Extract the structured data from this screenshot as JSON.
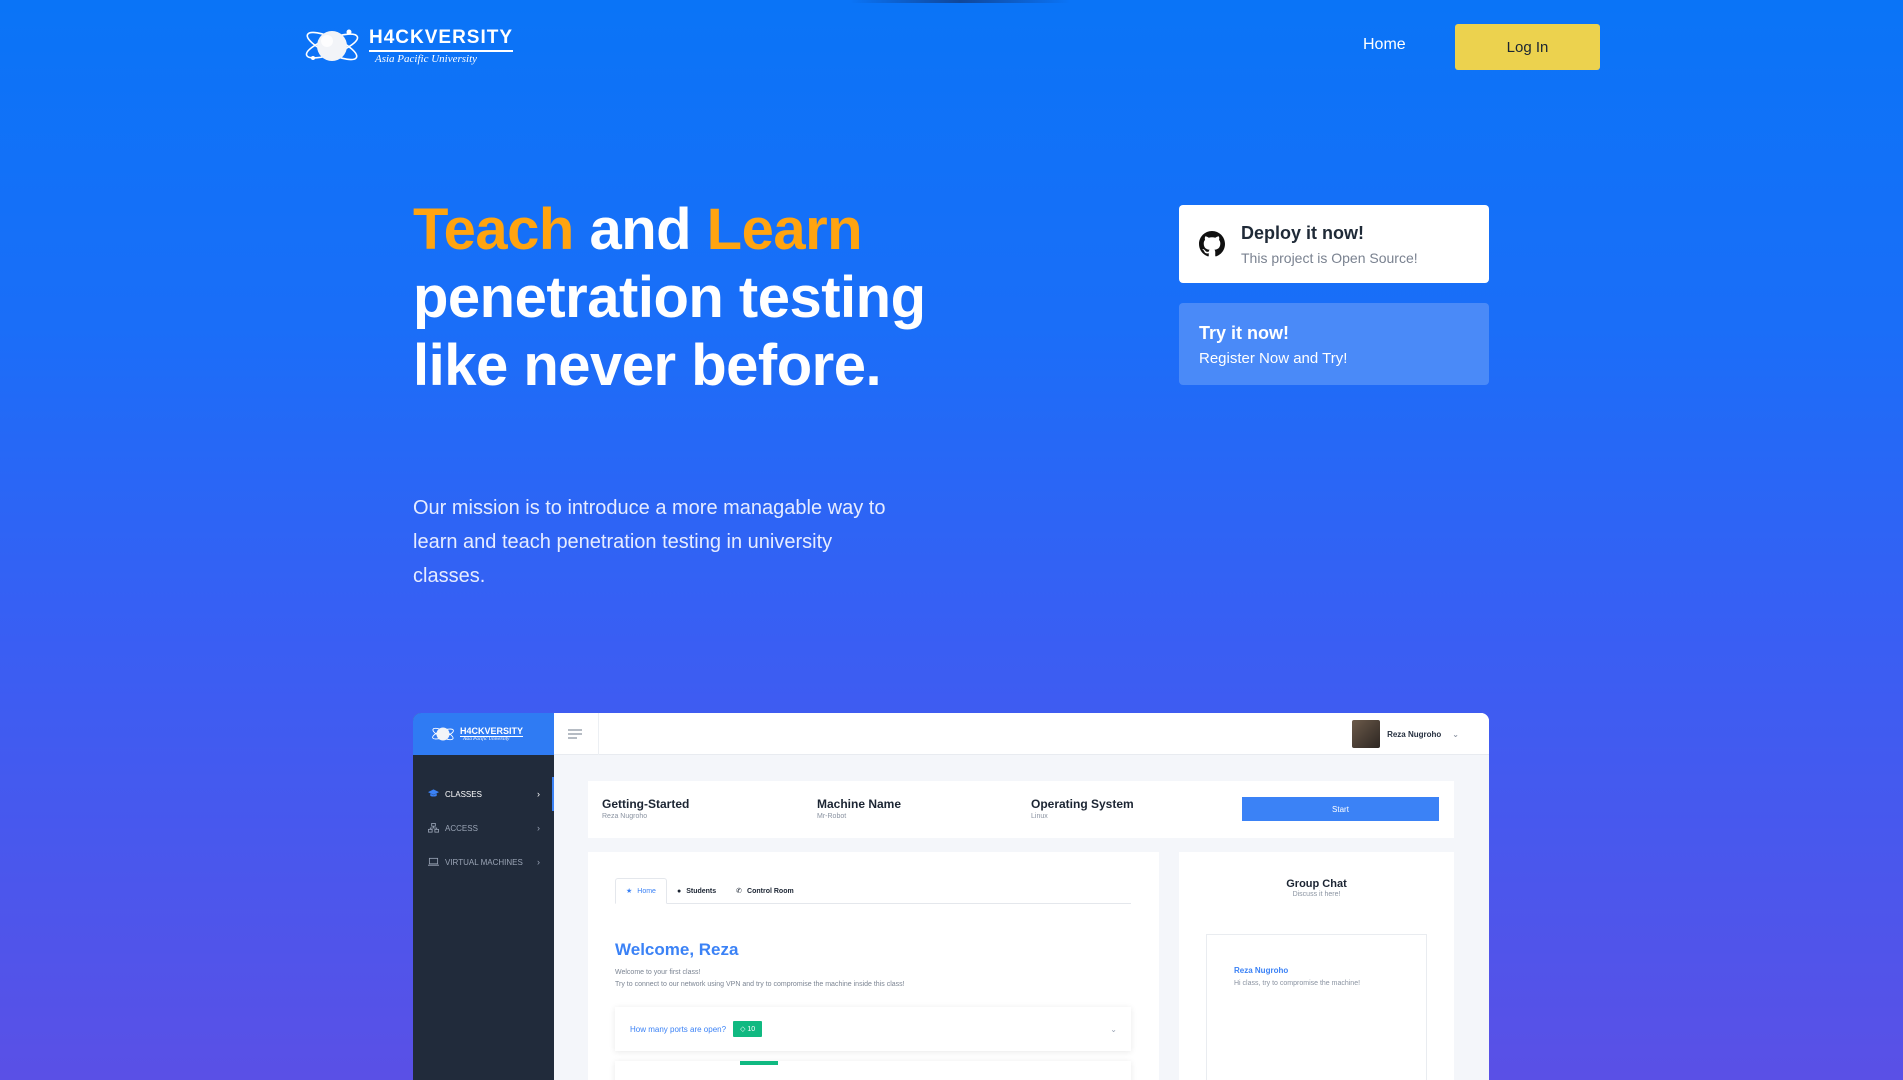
{
  "brand": {
    "name": "H4CKVERSITY",
    "subtitle": "Asia Pacific University",
    "globe_icon": "globe-icon"
  },
  "nav": {
    "home": "Home",
    "login": "Log In"
  },
  "hero": {
    "title_word1": "Teach",
    "title_and": " and ",
    "title_word2": "Learn",
    "title_rest": "penetration testing like never before.",
    "description": "Our mission is to introduce a more managable way to learn and teach penetration testing in university classes."
  },
  "cards": {
    "deploy": {
      "icon": "github-icon",
      "title": "Deploy it now!",
      "subtitle": "This project is Open Source!"
    },
    "try": {
      "title": "Try it now!",
      "subtitle": "Register Now and Try!"
    }
  },
  "preview": {
    "sidebar": {
      "brand": "H4CKVERSITY",
      "brand_sub": "Asia Pacific University",
      "items": [
        {
          "label": "CLASSES",
          "icon": "graduation-cap-icon",
          "active": true
        },
        {
          "label": "ACCESS",
          "icon": "network-icon",
          "active": false
        },
        {
          "label": "VIRTUAL MACHINES",
          "icon": "laptop-icon",
          "active": false
        }
      ]
    },
    "user": {
      "name": "Reza Nugroho"
    },
    "class_strip": {
      "class_name": "Getting-Started",
      "class_owner": "Reza Nugroho",
      "machine_label": "Machine Name",
      "machine_value": "Mr-Robot",
      "os_label": "Operating System",
      "os_value": "Linux",
      "start": "Start"
    },
    "tabs": [
      "Home",
      "Students",
      "Control Room"
    ],
    "welcome": "Welcome, Reza",
    "welcome_line1": "Welcome to your first class!",
    "welcome_line2": "Try to connect to our network using VPN and try to compromise the machine inside this class!",
    "question": "How many ports are open?",
    "question_points": "10",
    "chat": {
      "title": "Group Chat",
      "subtitle": "Discuss it here!",
      "sender": "Reza Nugroho",
      "message": "Hi class, try to compromise the machine!"
    }
  },
  "colors": {
    "accent": "#ffa410",
    "login_bg": "#ecd24e",
    "primary": "#3b82f6",
    "badge_green": "#10b981"
  }
}
